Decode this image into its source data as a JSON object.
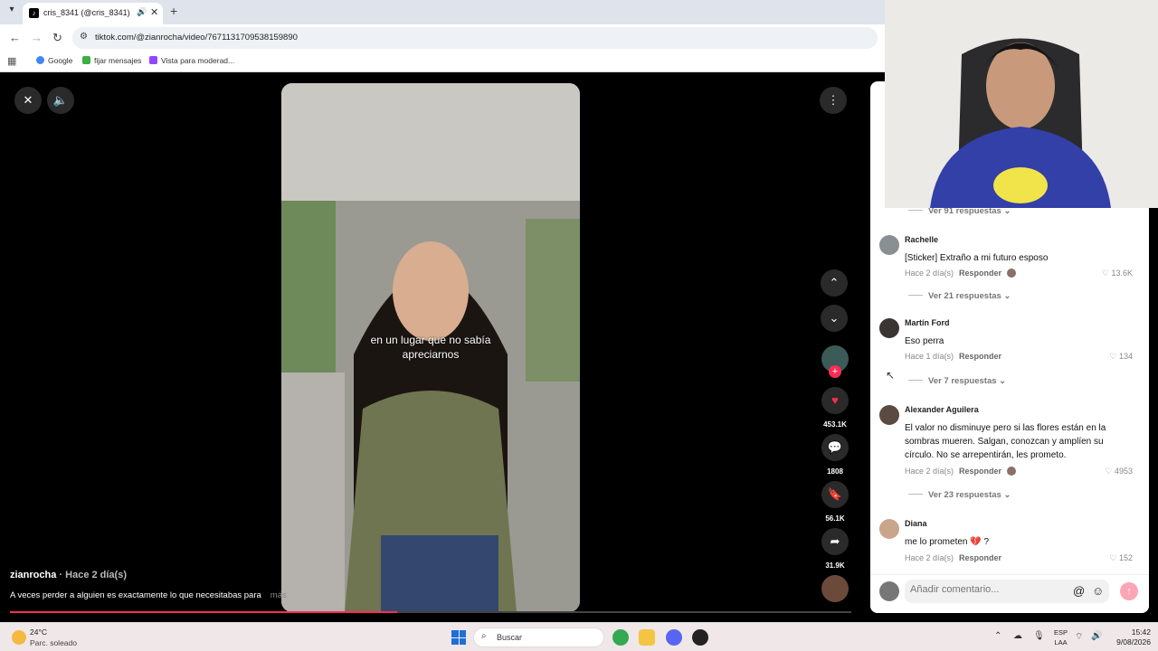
{
  "browser": {
    "tab_title": "cris_8341 (@cris_8341) | TikTok",
    "url": "tiktok.com/@zianrocha/video/7671131709538159890",
    "bookmarks": [
      "Google",
      "fijar mensajes",
      "Vista para moderad..."
    ]
  },
  "video": {
    "overlay_line1": "en un lugar que no sabía",
    "overlay_line2": "apreciarnos",
    "author": "zianrocha",
    "posted": " · Hace 2 día(s)",
    "description": "A veces perder a alguien es exactamente lo que necesitabas para",
    "more": "más",
    "progress": 0.46,
    "actions": {
      "likes": "453.1K",
      "comments": "1808",
      "saves": "56.1K",
      "shares": "31.9K"
    }
  },
  "comments": {
    "replies_top": "Ver 91 respuestas",
    "items": [
      {
        "name": "Rachelle",
        "text": "[Sticker] Extraño a mi futuro esposo",
        "time": "Hace 2 día(s)",
        "reply": "Responder",
        "likes": "13.6K",
        "replies": "Ver 21 respuestas"
      },
      {
        "name": "Martín Ford",
        "text": "Eso perra",
        "time": "Hace 1 día(s)",
        "reply": "Responder",
        "likes": "134",
        "replies": "Ver 7 respuestas"
      },
      {
        "name": "Alexander Aguilera",
        "text": "El valor no disminuye pero si las flores están en la sombras mueren. Salgan, conozcan y amplíen su círculo. No se arrepentirán, les prometo.",
        "time": "Hace 2 día(s)",
        "reply": "Responder",
        "likes": "4953",
        "replies": "Ver 23 respuestas"
      },
      {
        "name": "Diana",
        "text": "me lo prometen 💔 ?",
        "time": "Hace 2 día(s)",
        "reply": "Responder",
        "likes": "152"
      }
    ],
    "placeholder": "Añadir comentario..."
  },
  "taskbar": {
    "temp": "24°C",
    "weather": "Parc. soleado",
    "search": "Buscar",
    "lang1": "ESP",
    "lang2": "LAA",
    "time": "15:42",
    "date": "9/08/2026"
  }
}
